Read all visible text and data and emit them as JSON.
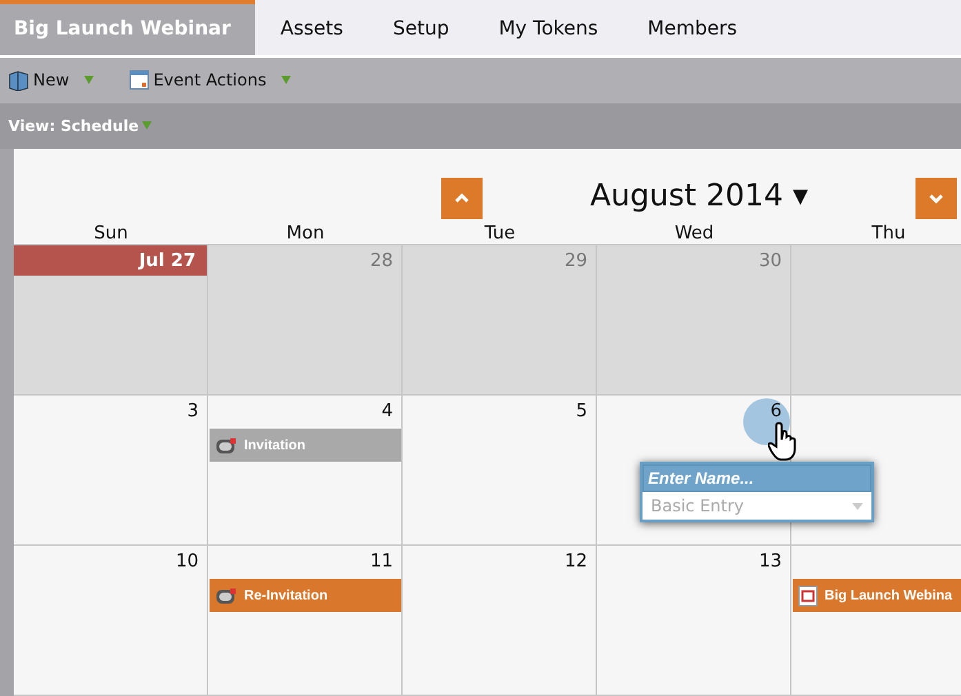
{
  "tabs": [
    {
      "label": "Big Launch Webinar",
      "selected": true
    },
    {
      "label": "Assets",
      "selected": false
    },
    {
      "label": "Setup",
      "selected": false
    },
    {
      "label": "My Tokens",
      "selected": false
    },
    {
      "label": "Members",
      "selected": false
    }
  ],
  "toolbar": [
    {
      "label": "New",
      "kind": "new"
    },
    {
      "label": "Event Actions",
      "kind": "calendar"
    }
  ],
  "view": {
    "label": "View: Schedule"
  },
  "calendar": {
    "month": "August 2014",
    "caret": "▾",
    "weekdays": [
      "Sun",
      "Mon",
      "Tue",
      "Wed",
      "Thu"
    ],
    "weeks": [
      {
        "days": [
          {
            "date": "Jul 27",
            "kind": "today"
          },
          {
            "date": "28",
            "kind": "prev"
          },
          {
            "date": "29",
            "kind": "prev"
          },
          {
            "date": "30",
            "kind": "prev"
          },
          {
            "kind": "prev"
          }
        ]
      },
      {
        "days": [
          {
            "date": "3",
            "kind": "current"
          },
          {
            "date": "4",
            "kind": "current",
            "events": [
              {
                "label": "Invitation",
                "color": "#a9a9a9",
                "kind": "email"
              }
            ]
          },
          {
            "date": "5",
            "kind": "current"
          },
          {
            "date": "6",
            "kind": "current",
            "hover": true,
            "popup": {
              "placeholder": "Enter Name...",
              "type": "Basic Entry"
            }
          },
          {
            "kind": "current"
          }
        ]
      },
      {
        "days": [
          {
            "date": "10",
            "kind": "current"
          },
          {
            "date": "11",
            "kind": "current",
            "events": [
              {
                "label": "Re-Invitation",
                "color": "#d9782c",
                "kind": "email"
              }
            ]
          },
          {
            "date": "12",
            "kind": "current"
          },
          {
            "date": "13",
            "kind": "current"
          },
          {
            "kind": "current",
            "events": [
              {
                "label": "Big Launch Webina",
                "color": "#d9782c",
                "kind": "webinar"
              }
            ]
          }
        ]
      }
    ]
  }
}
